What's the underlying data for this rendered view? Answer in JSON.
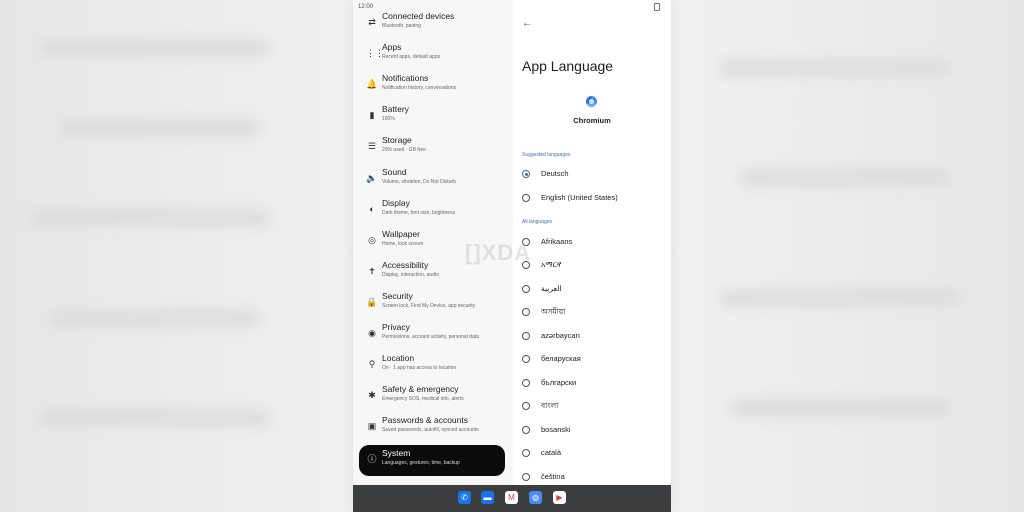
{
  "status_bar": {
    "time": "12:00"
  },
  "settings_list": [
    {
      "title": "Connected devices",
      "subtitle": "Bluetooth, pairing",
      "icon": "connected-devices-icon",
      "glyph": "⇄"
    },
    {
      "title": "Apps",
      "subtitle": "Recent apps, default apps",
      "icon": "apps-icon",
      "glyph": "⋮⋮"
    },
    {
      "title": "Notifications",
      "subtitle": "Notification history, conversations",
      "icon": "bell-icon",
      "glyph": "🔔"
    },
    {
      "title": "Battery",
      "subtitle": "100%",
      "icon": "battery-icon",
      "glyph": "▮"
    },
    {
      "title": "Storage",
      "subtitle": "29% used · GB free",
      "icon": "storage-icon",
      "glyph": "☰"
    },
    {
      "title": "Sound",
      "subtitle": "Volume, vibration, Do Not Disturb",
      "icon": "speaker-icon",
      "glyph": "🔈"
    },
    {
      "title": "Display",
      "subtitle": "Dark theme, font size, brightness",
      "icon": "display-icon",
      "glyph": "◐"
    },
    {
      "title": "Wallpaper",
      "subtitle": "Home, lock screen",
      "icon": "palette-icon",
      "glyph": "◎"
    },
    {
      "title": "Accessibility",
      "subtitle": "Display, interaction, audio",
      "icon": "accessibility-icon",
      "glyph": "✝"
    },
    {
      "title": "Security",
      "subtitle": "Screen lock, Find My Device, app security",
      "icon": "lock-icon",
      "glyph": "🔒"
    },
    {
      "title": "Privacy",
      "subtitle": "Permissions, account activity, personal data",
      "icon": "eye-icon",
      "glyph": "◉"
    },
    {
      "title": "Location",
      "subtitle": "On · 1 app has access to location",
      "icon": "location-pin-icon",
      "glyph": "⚲"
    },
    {
      "title": "Safety & emergency",
      "subtitle": "Emergency SOS, medical info, alerts",
      "icon": "emergency-icon",
      "glyph": "✱"
    },
    {
      "title": "Passwords & accounts",
      "subtitle": "Saved passwords, autofill, synced accounts",
      "icon": "account-icon",
      "glyph": "▣"
    },
    {
      "title": "System",
      "subtitle": "Languages, gestures, time, backup",
      "icon": "info-icon",
      "glyph": "ⓘ"
    }
  ],
  "app_language": {
    "title": "App Language",
    "app_name": "Chromium",
    "suggested_header": "Suggested languages",
    "all_header": "All languages",
    "suggested": [
      {
        "label": "Deutsch",
        "selected": true
      },
      {
        "label": "English (United States)",
        "selected": false
      }
    ],
    "all": [
      "Afrikaans",
      "አማርኛ",
      "العربية",
      "অসমীয়া",
      "azərbaycan",
      "беларуская",
      "български",
      "বাংলা",
      "bosanski",
      "català",
      "čeština"
    ]
  },
  "dock": [
    {
      "name": "phone-app-icon",
      "glyph": "✆",
      "color": "#1a73e8"
    },
    {
      "name": "messages-app-icon",
      "glyph": "▬",
      "color": "#1a73e8"
    },
    {
      "name": "gmail-app-icon",
      "glyph": "M",
      "color": "#ffffff"
    },
    {
      "name": "chromium-app-icon",
      "glyph": "◍",
      "color": "#4a8af4"
    },
    {
      "name": "play-store-app-icon",
      "glyph": "▶",
      "color": "#ffffff"
    }
  ],
  "watermark": {
    "left": "[]",
    "right": "XDA"
  }
}
